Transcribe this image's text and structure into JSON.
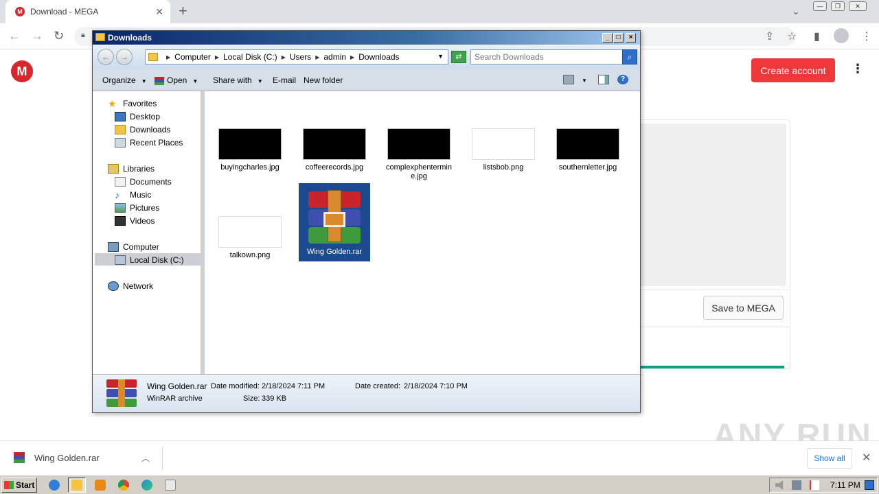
{
  "browser": {
    "tab_title": "Download - MEGA",
    "tab_favicon": "M",
    "close_tab": "✕",
    "new_tab": "+"
  },
  "mega": {
    "logo": "M",
    "create_account": "Create account",
    "save_to_mega": "Save to MEGA",
    "progress_fraction": 1.0,
    "colors": {
      "brand": "#d9272e",
      "button": "#f0373a",
      "progress": "#00a382"
    }
  },
  "explorer": {
    "title": "Downloads",
    "address": [
      "Computer",
      "Local Disk (C:)",
      "Users",
      "admin",
      "Downloads"
    ],
    "search_placeholder": "Search Downloads",
    "commands": {
      "organize": "Organize",
      "open": "Open",
      "share_with": "Share with",
      "email": "E-mail",
      "new_folder": "New folder"
    },
    "nav": {
      "favorites": "Favorites",
      "desktop": "Desktop",
      "downloads": "Downloads",
      "recent_places": "Recent Places",
      "libraries": "Libraries",
      "documents": "Documents",
      "music": "Music",
      "pictures": "Pictures",
      "videos": "Videos",
      "computer": "Computer",
      "local_disk": "Local Disk (C:)",
      "network": "Network"
    },
    "files": [
      {
        "name": "buyingcharles.jpg",
        "thumb": "black"
      },
      {
        "name": "coffeerecords.jpg",
        "thumb": "black"
      },
      {
        "name": "complexphentermine.jpg",
        "thumb": "black"
      },
      {
        "name": "listsbob.png",
        "thumb": "white"
      },
      {
        "name": "southernletter.jpg",
        "thumb": "black"
      },
      {
        "name": "talkown.png",
        "thumb": "white"
      },
      {
        "name": "Wing Golden.rar",
        "thumb": "winrar",
        "selected": true
      }
    ],
    "details": {
      "name": "Wing Golden.rar",
      "type": "WinRAR archive",
      "modified_label": "Date modified:",
      "modified_value": "2/18/2024 7:11 PM",
      "created_label": "Date created:",
      "created_value": "2/18/2024 7:10 PM",
      "size_label": "Size:",
      "size_value": "339 KB"
    }
  },
  "download_bar": {
    "file_name": "Wing Golden.rar",
    "show_all": "Show all",
    "close": "✕"
  },
  "watermark": "ANY RUN",
  "taskbar": {
    "start": "Start",
    "clock": "7:11 PM"
  }
}
